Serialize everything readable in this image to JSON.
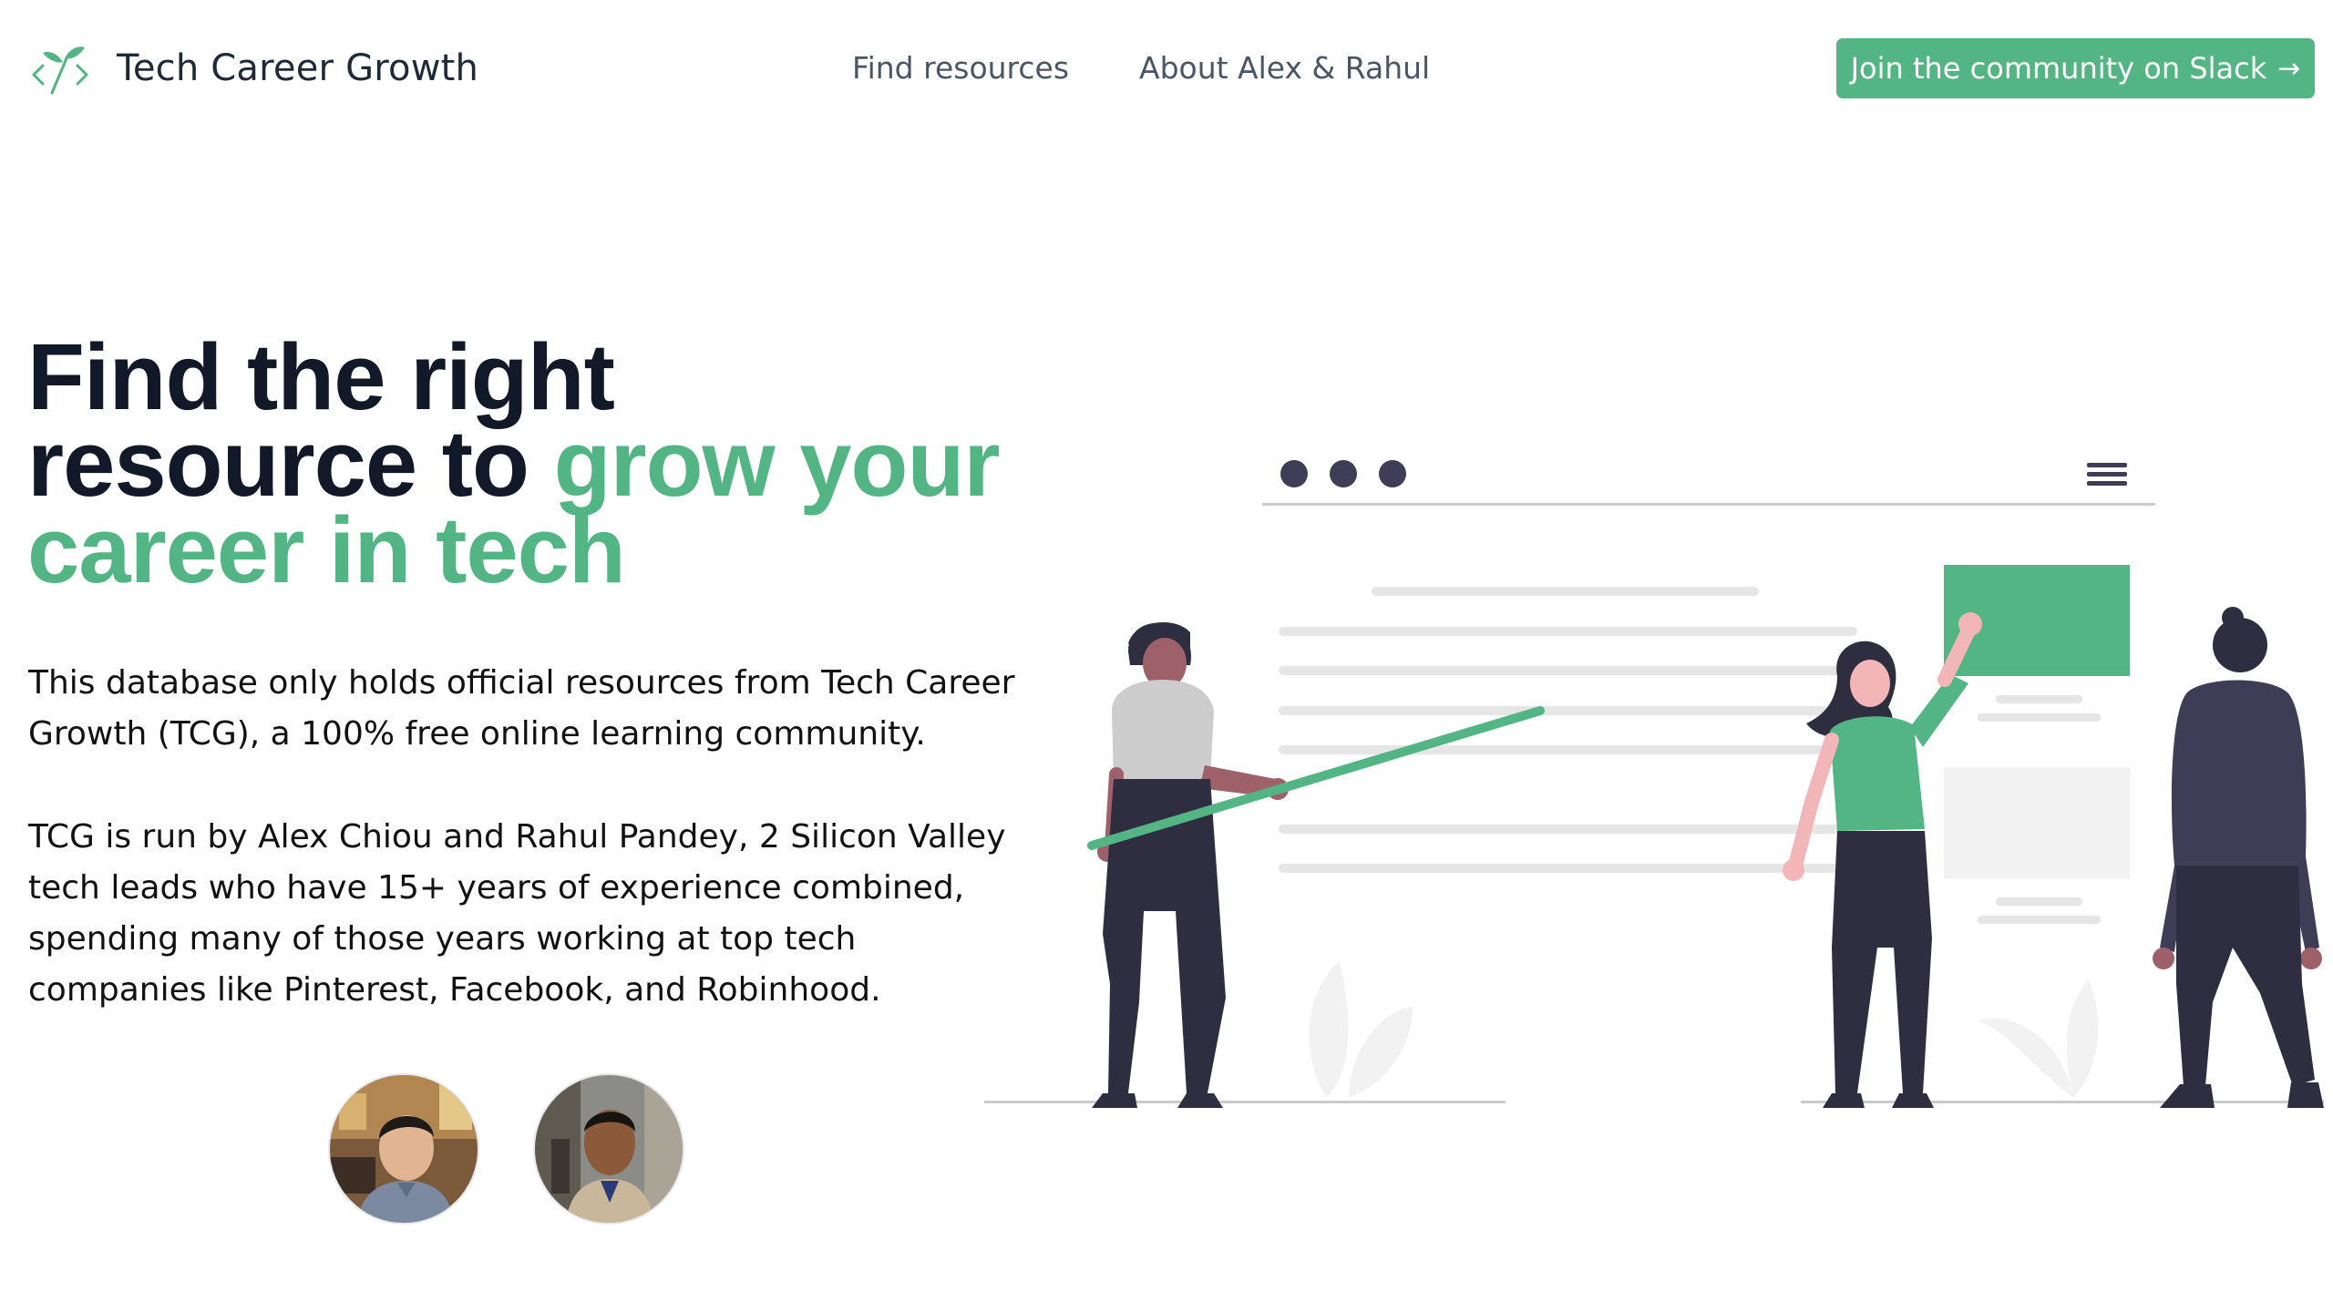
{
  "brand": {
    "name": "Tech Career Growth",
    "accent_color": "#52b583",
    "icon": "sprout-code-icon"
  },
  "nav": {
    "items": [
      {
        "label": "Find resources"
      },
      {
        "label": "About Alex & Rahul"
      }
    ]
  },
  "cta": {
    "label": "Join the community on Slack",
    "icon": "arrow-right-icon",
    "arrow": "→"
  },
  "hero": {
    "title_plain_1": "Find the right",
    "title_plain_2": "resource to",
    "title_accent_1": "grow your",
    "title_accent_2": "career in tech",
    "paragraph_1": "This database only holds official resources from Tech Career Growth (TCG), a 100% free online learning community.",
    "paragraph_2": "TCG is run by Alex Chiou and Rahul Pandey, 2 Silicon Valley tech leads who have 15+ years of experience combined, spending many of those years working at top tech companies like Pinterest, Facebook, and Robinhood."
  },
  "founders": [
    {
      "name": "Alex Chiou",
      "image": "avatar-photo"
    },
    {
      "name": "Rahul Pandey",
      "image": "avatar-photo"
    }
  ],
  "illustration": {
    "subject": "team-collaboration-illustration",
    "colors": {
      "accent": "#52b583",
      "dark": "#2f2e41",
      "light_gray": "#e6e6e6",
      "shirt_gray": "#cccccc",
      "skin_dark": "#9e616a",
      "skin_pink": "#f2b6b9"
    }
  }
}
